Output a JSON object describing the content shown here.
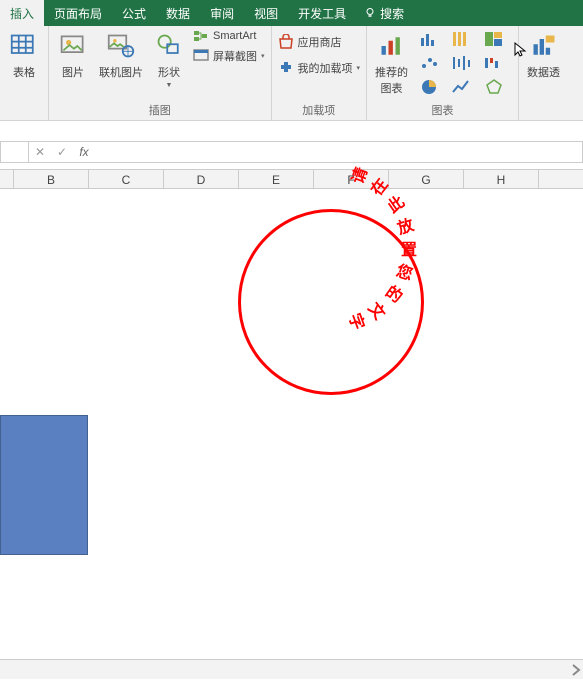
{
  "tabs": {
    "insert": "插入",
    "pageLayout": "页面布局",
    "formulas": "公式",
    "data": "数据",
    "review": "审阅",
    "view": "视图",
    "devTools": "开发工具",
    "search": "搜索"
  },
  "ribbon": {
    "tables": {
      "table": "表格"
    },
    "illustrations": {
      "picture": "图片",
      "onlinePic": "联机图片",
      "shapes": "形状",
      "smartart": "SmartArt",
      "screenshot": "屏幕截图",
      "groupLabel": "插图"
    },
    "addins": {
      "store": "应用商店",
      "myAddins": "我的加载项",
      "groupLabel": "加载项"
    },
    "charts": {
      "recommended": "推荐的\n图表",
      "groupLabel": "图表"
    },
    "pivot": {
      "label": "数据透"
    }
  },
  "columns": [
    "B",
    "C",
    "D",
    "E",
    "F",
    "G",
    "H"
  ],
  "circleText": "请在此放置您的文字",
  "colors": {
    "brand": "#217346",
    "accentRed": "#ff0000",
    "shapeBlue": "#5a80c2"
  }
}
